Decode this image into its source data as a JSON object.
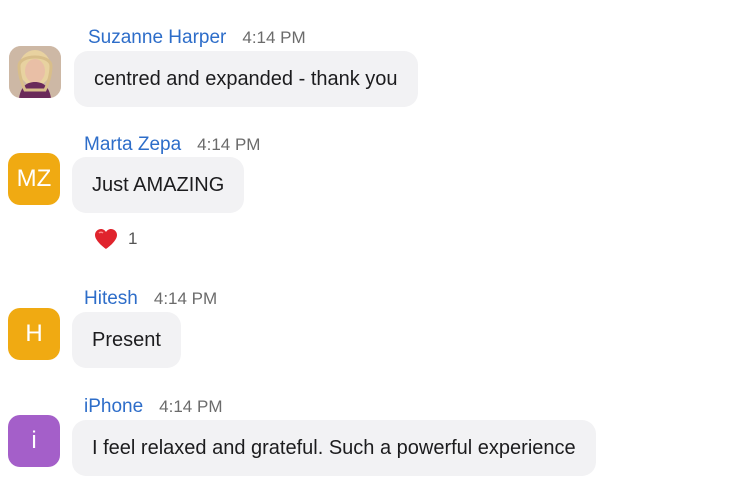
{
  "messages": [
    {
      "sender": "Suzanne Harper",
      "time": "4:14 PM",
      "text": "centred and expanded - thank you",
      "avatar": {
        "type": "photo",
        "color": "#8a5c7a"
      }
    },
    {
      "sender": "Marta Zepa",
      "time": "4:14 PM",
      "text": "Just AMAZING",
      "avatar": {
        "type": "initials",
        "initials": "MZ",
        "color": "#f0aa12"
      },
      "reaction": {
        "icon": "heart-icon",
        "count": "1"
      }
    },
    {
      "sender": "Hitesh",
      "time": "4:14 PM",
      "text": "Present",
      "avatar": {
        "type": "initials",
        "initials": "H",
        "color": "#f0aa12"
      }
    },
    {
      "sender": "iPhone",
      "time": "4:14 PM",
      "text": "I feel relaxed and grateful. Such a powerful experience",
      "avatar": {
        "type": "initials",
        "initials": "i",
        "color": "#a45fc9"
      }
    }
  ],
  "colors": {
    "sender_name": "#2d6dc9",
    "bubble_background": "#f2f2f4",
    "timestamp": "#6b6b6b",
    "heart": "#e0242d"
  }
}
